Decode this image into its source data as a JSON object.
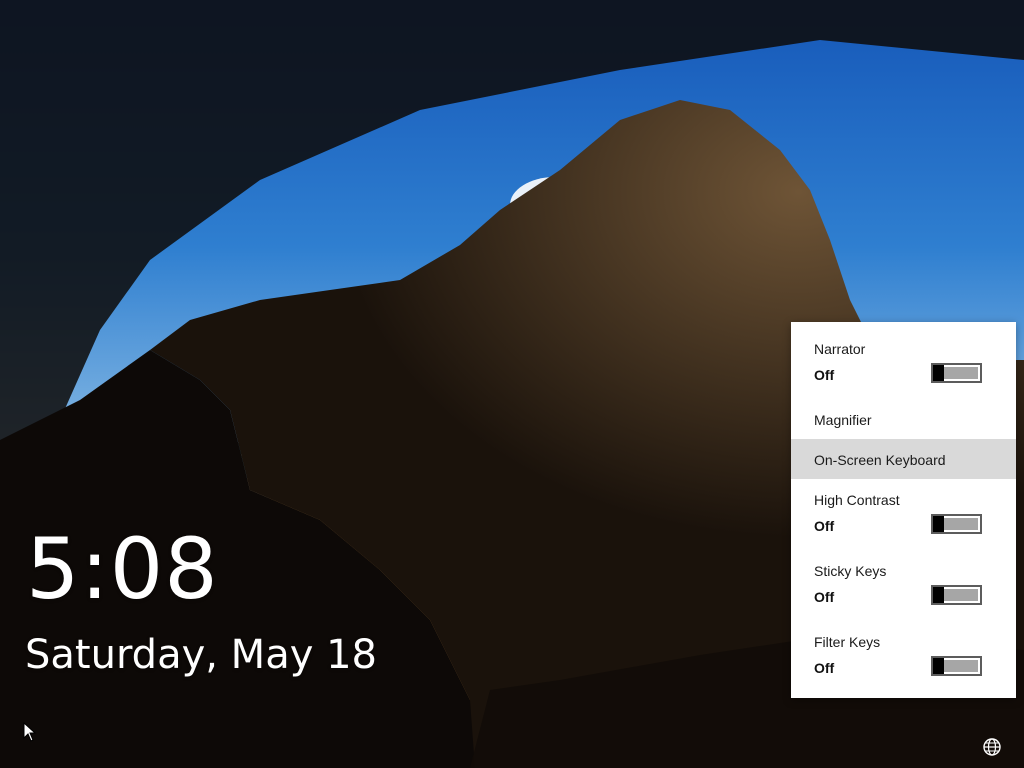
{
  "lock_screen": {
    "time": "5:08",
    "date": "Saturday, May 18"
  },
  "ease_of_access": {
    "narrator": {
      "label": "Narrator",
      "state": "Off",
      "on": false
    },
    "magnifier": {
      "label": "Magnifier"
    },
    "on_screen_keyboard": {
      "label": "On-Screen Keyboard"
    },
    "high_contrast": {
      "label": "High Contrast",
      "state": "Off",
      "on": false
    },
    "sticky_keys": {
      "label": "Sticky Keys",
      "state": "Off",
      "on": false
    },
    "filter_keys": {
      "label": "Filter Keys",
      "state": "Off",
      "on": false
    }
  },
  "icons": {
    "accessibility": "ease-of-access-icon",
    "pointer": "mouse-pointer-icon"
  },
  "colors": {
    "panel_bg": "#ffffff",
    "hover_bg": "#d9d9d9",
    "toggle_off_track": "#a6a6a6",
    "clock_text": "#ffffff"
  }
}
